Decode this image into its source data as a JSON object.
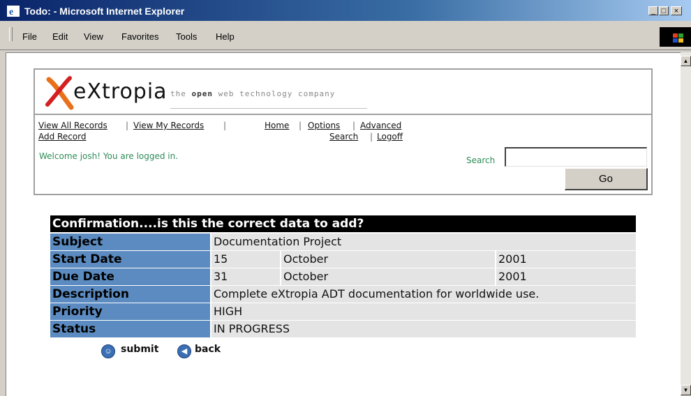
{
  "window": {
    "title": "Todo: - Microsoft Internet Explorer",
    "min": "_",
    "max": "□",
    "close": "×"
  },
  "menu": {
    "file": "File",
    "edit": "Edit",
    "view": "View",
    "favorites": "Favorites",
    "tools": "Tools",
    "help": "Help"
  },
  "brand": {
    "name": "eXtropia",
    "tagline_pre": "the ",
    "tagline_bold": "open",
    "tagline_post": " web technology company"
  },
  "nav": {
    "view_all": "View All Records",
    "view_my": "View My Records",
    "add_record": "Add Record",
    "home": "Home",
    "options": "Options",
    "advanced": "Advanced",
    "search": "Search",
    "logoff": "Logoff",
    "sep": "|"
  },
  "welcome": "Welcome josh! You are logged in.",
  "search": {
    "label": "Search",
    "value": "",
    "go": "Go"
  },
  "confirm": {
    "heading": "Confirmation....is this the correct data to add?",
    "rows": [
      {
        "label": "Subject",
        "value": "Documentation Project"
      },
      {
        "label": "Start Date",
        "day": "15",
        "month": "October",
        "year": "2001"
      },
      {
        "label": "Due Date",
        "day": "31",
        "month": "October",
        "year": "2001"
      },
      {
        "label": "Description",
        "value": "Complete eXtropia ADT documentation for worldwide use."
      },
      {
        "label": "Priority",
        "value": "HIGH"
      },
      {
        "label": "Status",
        "value": "IN PROGRESS"
      }
    ],
    "submit": "submit",
    "back": "back"
  },
  "colors": {
    "label_bg": "#5b8bc0",
    "value_bg": "#e4e4e4",
    "welcome": "#2e8b57",
    "titlebar": "#0a246a"
  }
}
